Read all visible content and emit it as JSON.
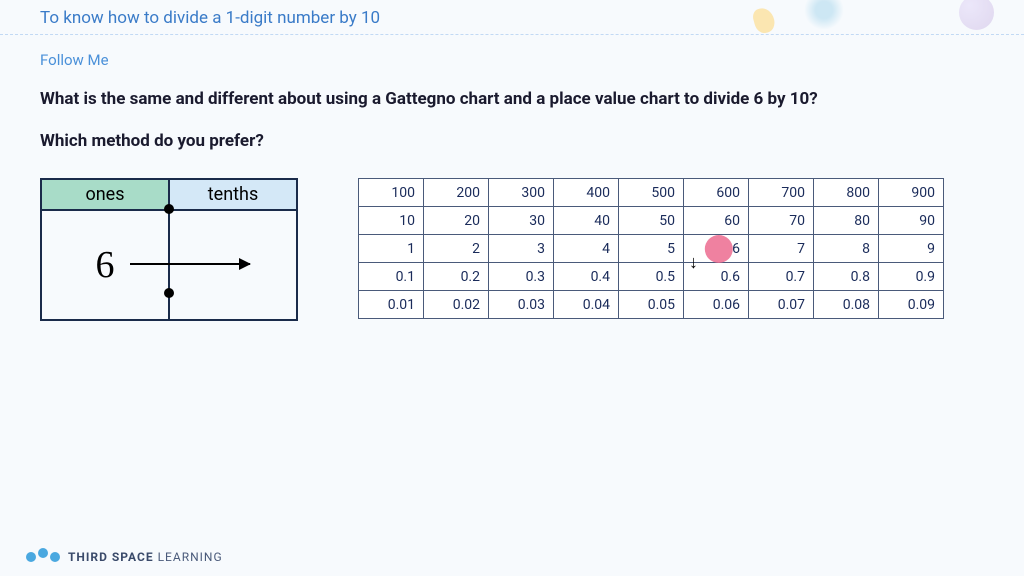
{
  "title": "To know how to divide a 1-digit number by 10",
  "section_label": "Follow Me",
  "question_line1": "What is the same and different about using a Gattegno chart and a place value chart to divide 6 by 10?",
  "question_line2": "Which method do you prefer?",
  "place_value": {
    "headers": {
      "ones": "ones",
      "tenths": "tenths"
    },
    "value": "6"
  },
  "gattegno": {
    "rows": [
      [
        "100",
        "200",
        "300",
        "400",
        "500",
        "600",
        "700",
        "800",
        "900"
      ],
      [
        "10",
        "20",
        "30",
        "40",
        "50",
        "60",
        "70",
        "80",
        "90"
      ],
      [
        "1",
        "2",
        "3",
        "4",
        "5",
        "6",
        "7",
        "8",
        "9"
      ],
      [
        "0.1",
        "0.2",
        "0.3",
        "0.4",
        "0.5",
        "0.6",
        "0.7",
        "0.8",
        "0.9"
      ],
      [
        "0.01",
        "0.02",
        "0.03",
        "0.04",
        "0.05",
        "0.06",
        "0.07",
        "0.08",
        "0.09"
      ]
    ],
    "highlight": {
      "row": 2,
      "col": 5
    },
    "arrow_between_rows": [
      2,
      3
    ],
    "arrow_col": 5
  },
  "brand": {
    "part1": "THIRD SPACE",
    "part2": " LEARNING"
  }
}
